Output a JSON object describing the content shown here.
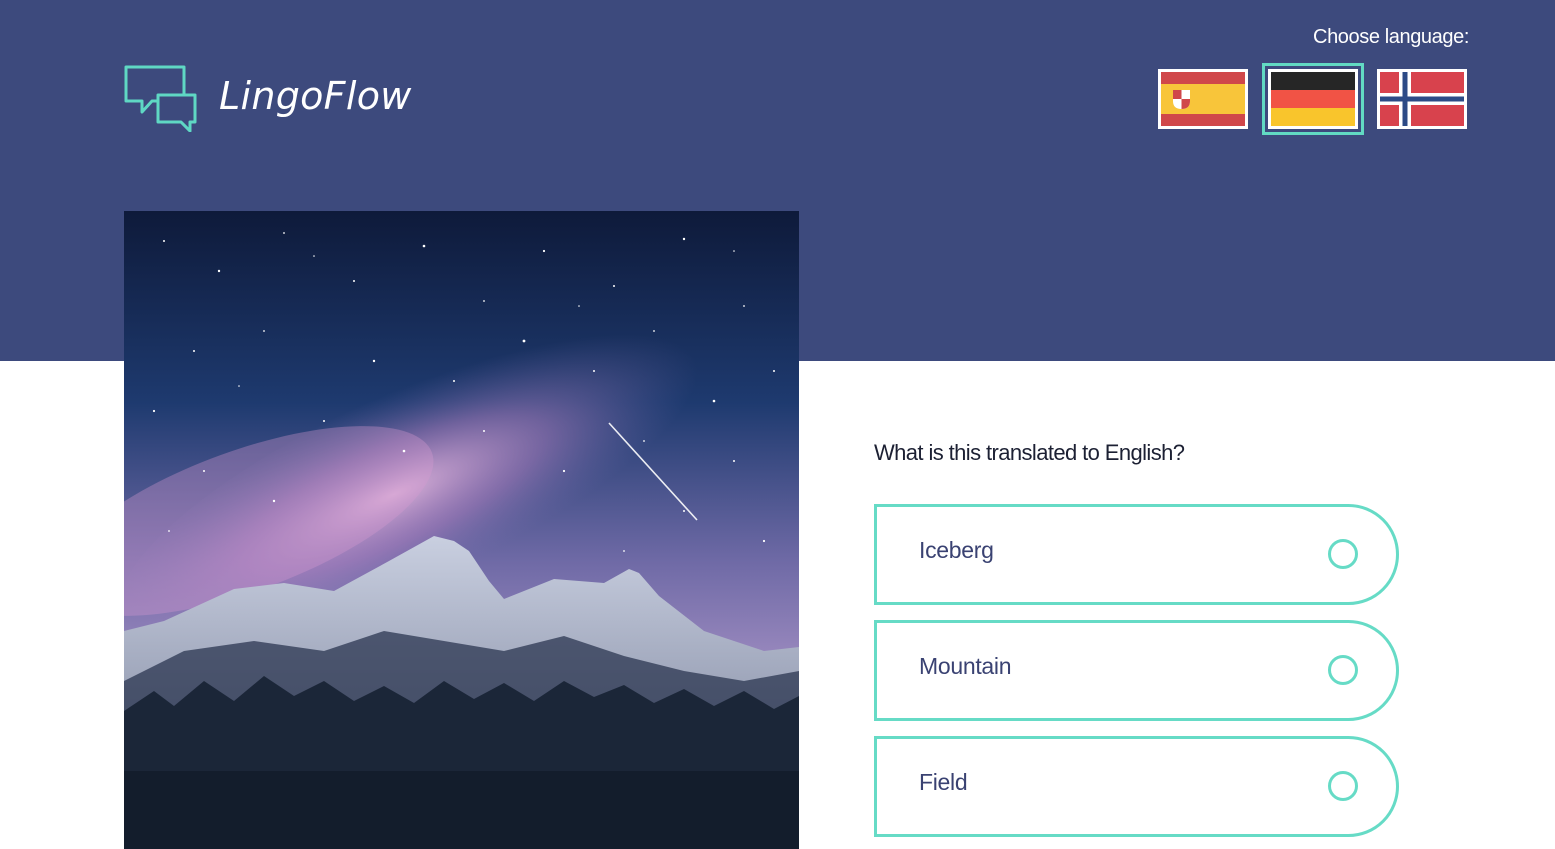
{
  "brand": {
    "name": "LingoFlow",
    "logo_icon": "chat-bubbles-icon"
  },
  "language_picker": {
    "label": "Choose language:",
    "selected": "de",
    "flags": [
      {
        "code": "es",
        "icon": "spain-flag-icon"
      },
      {
        "code": "de",
        "icon": "germany-flag-icon"
      },
      {
        "code": "no",
        "icon": "norway-flag-icon"
      }
    ]
  },
  "quiz": {
    "image": "starry-sky-mountains",
    "question": "What is this translated to English?",
    "options": [
      {
        "label": "Iceberg",
        "selected": false
      },
      {
        "label": "Mountain",
        "selected": false
      },
      {
        "label": "Field",
        "selected": false
      }
    ]
  },
  "colors": {
    "header_bg": "#3d4a7d",
    "accent": "#62dac3",
    "option_text": "#3a4272"
  }
}
